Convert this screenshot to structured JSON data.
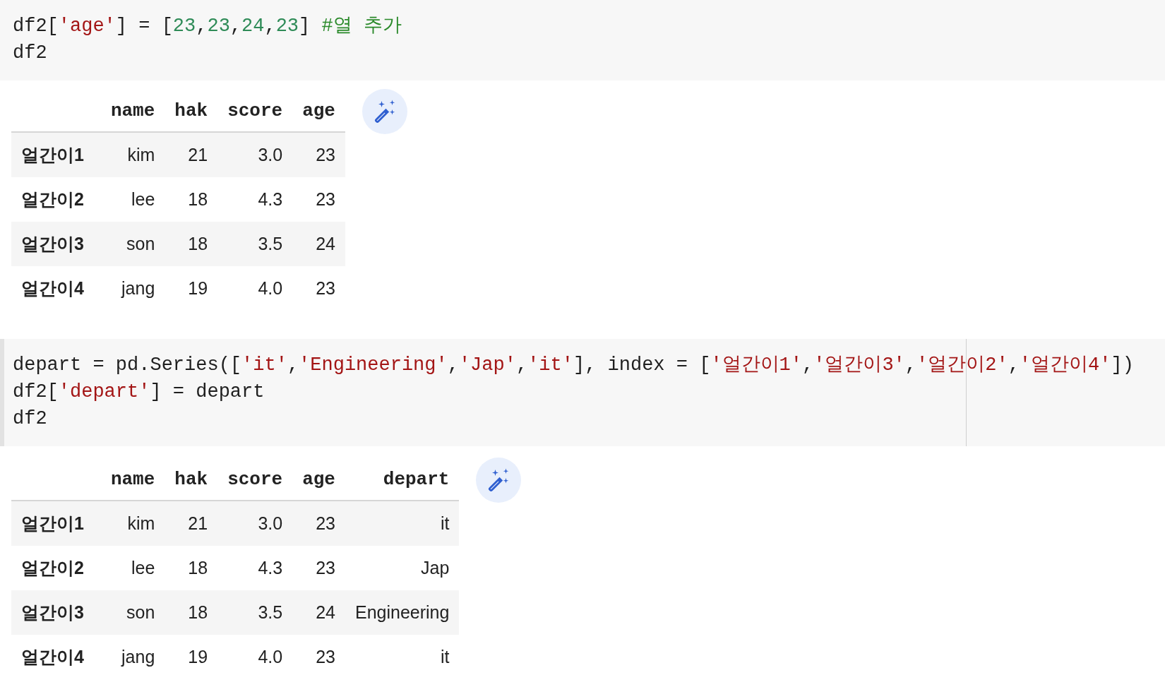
{
  "cells": [
    {
      "selected": false,
      "code": [
        [
          {
            "kind": "plain",
            "text": "df2["
          },
          {
            "kind": "string",
            "text": "'age'"
          },
          {
            "kind": "plain",
            "text": "] = ["
          },
          {
            "kind": "number",
            "text": "23"
          },
          {
            "kind": "plain",
            "text": ","
          },
          {
            "kind": "number",
            "text": "23"
          },
          {
            "kind": "plain",
            "text": ","
          },
          {
            "kind": "number",
            "text": "24"
          },
          {
            "kind": "plain",
            "text": ","
          },
          {
            "kind": "number",
            "text": "23"
          },
          {
            "kind": "plain",
            "text": "] "
          },
          {
            "kind": "comment",
            "text": "#열 추가"
          }
        ],
        [
          {
            "kind": "plain",
            "text": "df2"
          }
        ]
      ],
      "table": {
        "columns": [
          "name",
          "hak",
          "score",
          "age"
        ],
        "rows": [
          {
            "index": "얼간이1",
            "cells": [
              "kim",
              "21",
              "3.0",
              "23"
            ]
          },
          {
            "index": "얼간이2",
            "cells": [
              "lee",
              "18",
              "4.3",
              "23"
            ]
          },
          {
            "index": "얼간이3",
            "cells": [
              "son",
              "18",
              "3.5",
              "24"
            ]
          },
          {
            "index": "얼간이4",
            "cells": [
              "jang",
              "19",
              "4.0",
              "23"
            ]
          }
        ]
      }
    },
    {
      "selected": true,
      "code": [
        [
          {
            "kind": "plain",
            "text": "depart = pd.Series(["
          },
          {
            "kind": "string",
            "text": "'it'"
          },
          {
            "kind": "plain",
            "text": ","
          },
          {
            "kind": "string",
            "text": "'Engineering'"
          },
          {
            "kind": "plain",
            "text": ","
          },
          {
            "kind": "string",
            "text": "'Jap'"
          },
          {
            "kind": "plain",
            "text": ","
          },
          {
            "kind": "string",
            "text": "'it'"
          },
          {
            "kind": "plain",
            "text": "], index = ["
          },
          {
            "kind": "string",
            "text": "'얼간이1'"
          },
          {
            "kind": "plain",
            "text": ","
          },
          {
            "kind": "string",
            "text": "'얼간이3'"
          },
          {
            "kind": "plain",
            "text": ","
          },
          {
            "kind": "string",
            "text": "'얼간이2'"
          },
          {
            "kind": "plain",
            "text": ","
          },
          {
            "kind": "string",
            "text": "'얼간이4'"
          },
          {
            "kind": "plain",
            "text": "])"
          }
        ],
        [
          {
            "kind": "plain",
            "text": "df2["
          },
          {
            "kind": "string",
            "text": "'depart'"
          },
          {
            "kind": "plain",
            "text": "] = depart"
          }
        ],
        [
          {
            "kind": "plain",
            "text": "df2"
          }
        ]
      ],
      "table": {
        "columns": [
          "name",
          "hak",
          "score",
          "age",
          "depart"
        ],
        "rows": [
          {
            "index": "얼간이1",
            "cells": [
              "kim",
              "21",
              "3.0",
              "23",
              "it"
            ]
          },
          {
            "index": "얼간이2",
            "cells": [
              "lee",
              "18",
              "4.3",
              "23",
              "Jap"
            ]
          },
          {
            "index": "얼간이3",
            "cells": [
              "son",
              "18",
              "3.5",
              "24",
              "Engineering"
            ]
          },
          {
            "index": "얼간이4",
            "cells": [
              "jang",
              "19",
              "4.0",
              "23",
              "it"
            ]
          }
        ]
      }
    }
  ]
}
